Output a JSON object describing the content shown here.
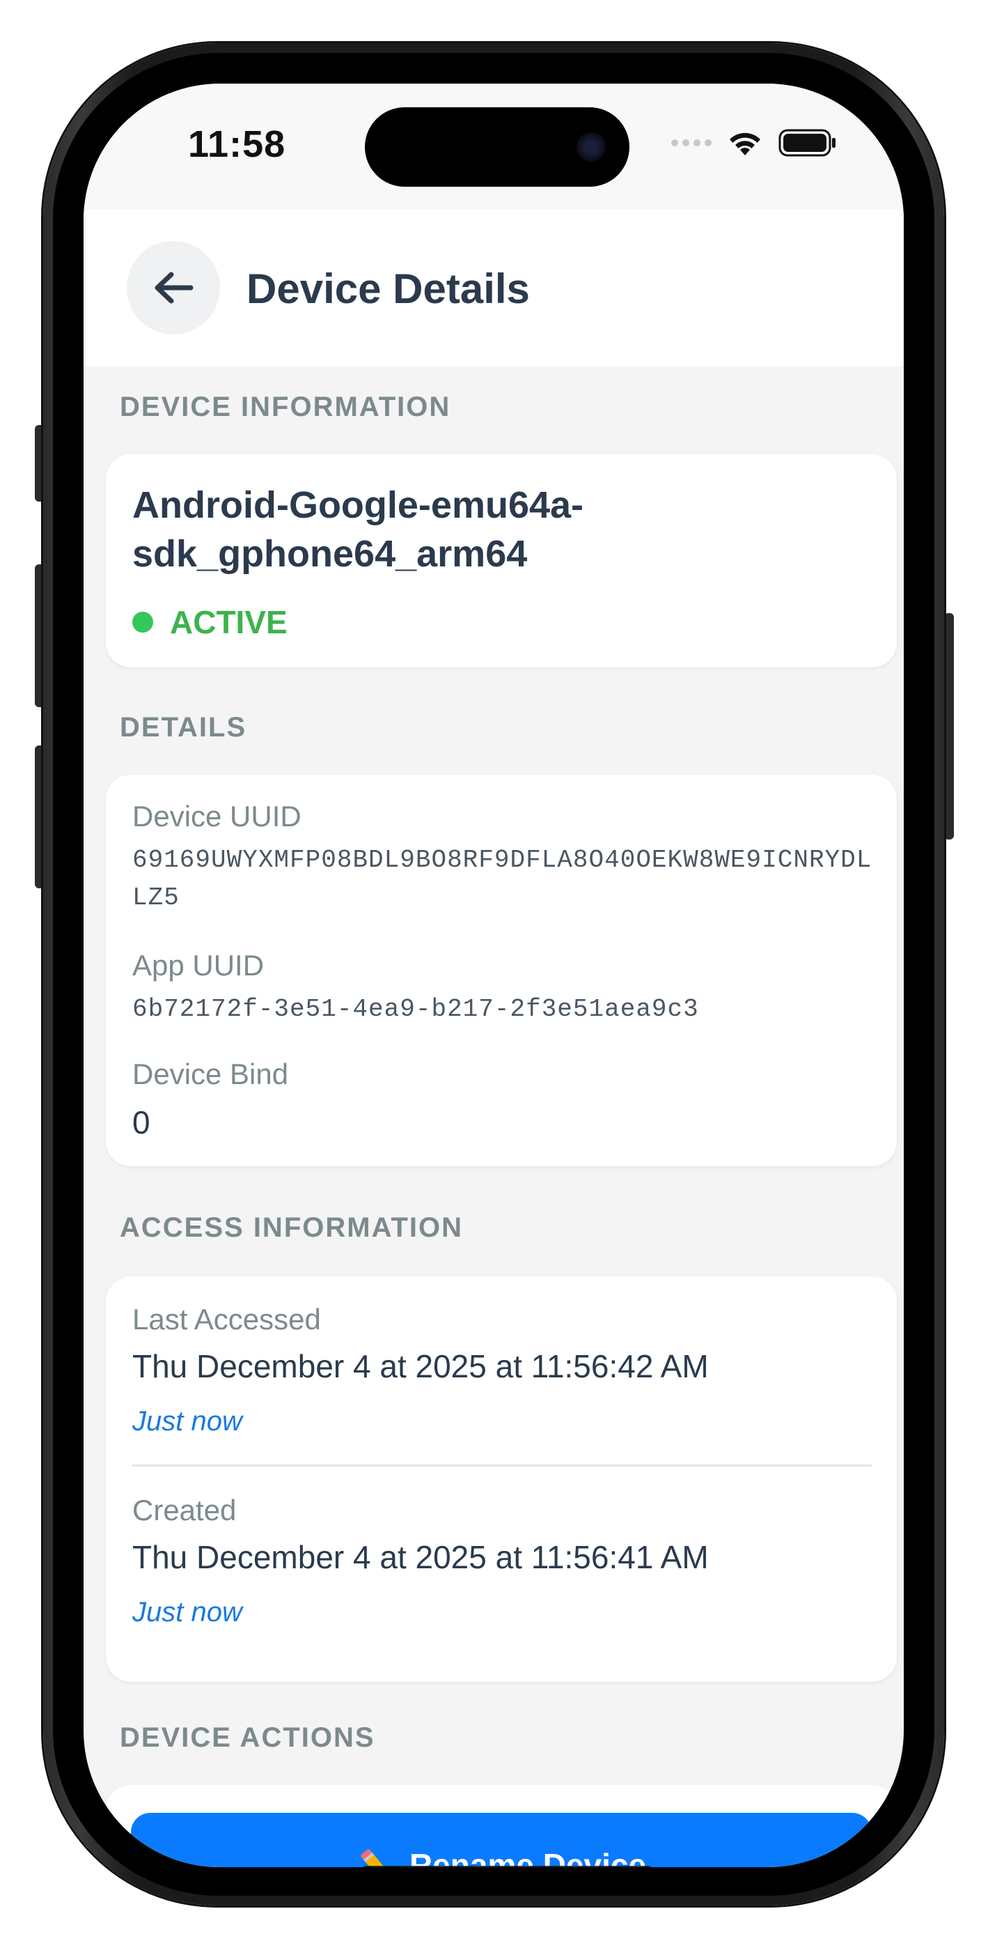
{
  "status_bar": {
    "time": "11:58"
  },
  "header": {
    "title": "Device Details",
    "back_icon": "arrow-left-icon"
  },
  "device_information": {
    "section_title": "DEVICE INFORMATION",
    "device_name": "Android-Google-emu64a-sdk_gphone64_arm64",
    "status": "ACTIVE",
    "status_color": "#34c759"
  },
  "details": {
    "section_title": "DETAILS",
    "device_uuid_label": "Device UUID",
    "device_uuid": "69169UWYXMFP08BDL9BO8RF9DFLA8O40OEKW8WE9ICNRYDLLZ5",
    "app_uuid_label": "App UUID",
    "app_uuid": "6b72172f-3e51-4ea9-b217-2f3e51aea9c3",
    "device_bind_label": "Device Bind",
    "device_bind": "0"
  },
  "access_information": {
    "section_title": "ACCESS INFORMATION",
    "last_accessed_label": "Last Accessed",
    "last_accessed": "Thu December 4 at 2025 at 11:56:42 AM",
    "last_accessed_relative": "Just now",
    "created_label": "Created",
    "created": "Thu December 4 at 2025 at 11:56:41 AM",
    "created_relative": "Just now"
  },
  "device_actions": {
    "section_title": "DEVICE ACTIONS",
    "rename_label": "Rename Device",
    "rename_icon": "pencil-icon"
  },
  "colors": {
    "accent": "#0a7bff",
    "link": "#1a7ae0",
    "title": "#2b3a4d"
  }
}
